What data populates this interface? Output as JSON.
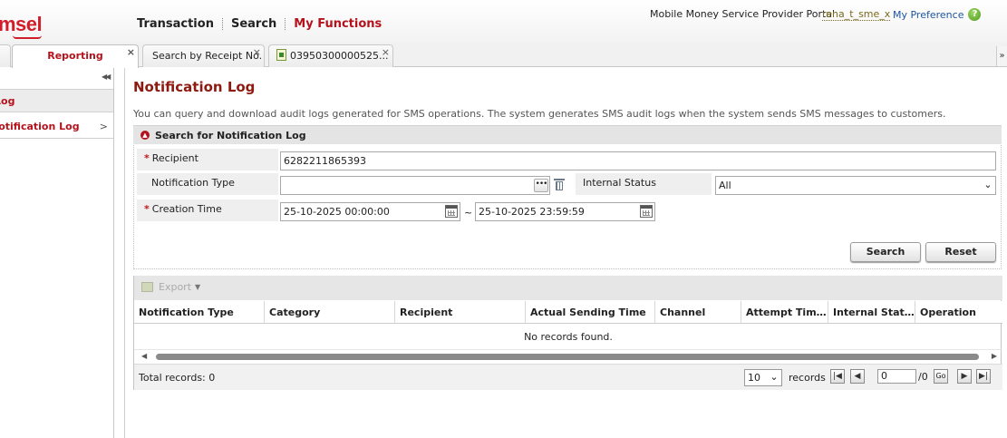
{
  "brand": {
    "logo_text": "msel",
    "brand_color": "#d21e2b"
  },
  "header": {
    "menu": [
      {
        "label": "Transaction",
        "active": false
      },
      {
        "label": "Search",
        "active": false
      },
      {
        "label": "My Functions",
        "active": true
      }
    ],
    "portal_name": "Mobile Money Service Provider Portal",
    "username": "rena_t_sme_x",
    "my_preference": "My Preference",
    "help_icon": "?"
  },
  "tabs": {
    "reporting": "Reporting",
    "receipt_search": "Search by Receipt No.",
    "document": "03950300000525...",
    "close_glyph": "×",
    "scroll_glyph": "»"
  },
  "sidebar": {
    "collapse_glyph": "◀◀",
    "group_label": "Log",
    "item_label": "Notification Log",
    "item_chevron": ">"
  },
  "page": {
    "title": "Notification Log",
    "description": "You can query and download audit logs generated for SMS operations. The system generates SMS audit logs when the system sends SMS messages to customers.",
    "section_title": "Search for Notification Log"
  },
  "form": {
    "recipient_label": "Recipient",
    "recipient_value": "6282211865393",
    "notification_type_label": "Notification Type",
    "notification_type_value": "",
    "internal_status_label": "Internal Status",
    "internal_status_value": "All",
    "creation_time_label": "Creation Time",
    "creation_from": "25-10-2025 00:00:00",
    "creation_to": "25-10-2025 23:59:59",
    "range_separator": "~",
    "required_mark": "*",
    "search_button": "Search",
    "reset_button": "Reset"
  },
  "results": {
    "export_label": "Export",
    "columns": [
      "Notification Type",
      "Category",
      "Recipient",
      "Actual Sending Time",
      "Channel",
      "Attempt Times",
      "Internal Stat...",
      "Operation"
    ],
    "empty_message": "No records found.",
    "total_label": "Total records: 0",
    "page_size": "10",
    "records_label": "records",
    "page_number": "0",
    "page_of": "/0",
    "go_label": "Go"
  },
  "colors": {
    "accent": "#b4121c",
    "title": "#8c1a10",
    "link": "#1d55a3"
  }
}
